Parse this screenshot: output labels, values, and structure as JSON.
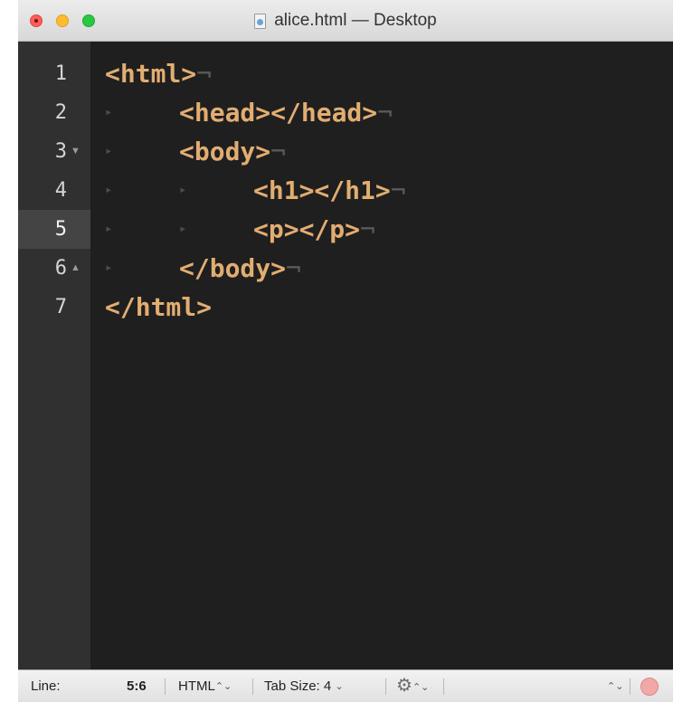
{
  "window": {
    "title": "alice.html — Desktop"
  },
  "icons": {
    "file": "html-document-icon",
    "close": "close-button",
    "minimize": "minimize-button",
    "zoom": "zoom-button",
    "fold": "fold-triangle-icon",
    "indent": "tab-indent-marker",
    "eol": "end-of-line-marker",
    "settings": "gear-icon",
    "stepper": "up-down-stepper-icon",
    "record": "record-macro-button"
  },
  "colors": {
    "tags": "#e2ad71",
    "editor_background": "#1f1f1f",
    "gutter_background": "#303030",
    "active_line": "#444444"
  },
  "gutter": {
    "lines": [
      {
        "number": "1",
        "fold": ""
      },
      {
        "number": "2",
        "fold": ""
      },
      {
        "number": "3",
        "fold": "▼"
      },
      {
        "number": "4",
        "fold": ""
      },
      {
        "number": "5",
        "fold": ""
      },
      {
        "number": "6",
        "fold": "▲"
      },
      {
        "number": "7",
        "fold": ""
      }
    ],
    "active_line": "5"
  },
  "code": {
    "indent_glyph": "▸",
    "eol_glyph": "¬",
    "lines": [
      {
        "text": "<html>"
      },
      {
        "text": "<head></head>"
      },
      {
        "text": "<body>"
      },
      {
        "text": "<h1></h1>"
      },
      {
        "text": "<p></p>"
      },
      {
        "text": "</body>"
      },
      {
        "text": "</html>"
      }
    ]
  },
  "status": {
    "line_label": "Line:",
    "position": "5:6",
    "language": "HTML",
    "tab_size_label": "Tab Size:",
    "tab_size": "4",
    "tab_chevron": "⌄",
    "stepper_glyph": "⌃⌄",
    "gear_glyph": "⚙"
  }
}
